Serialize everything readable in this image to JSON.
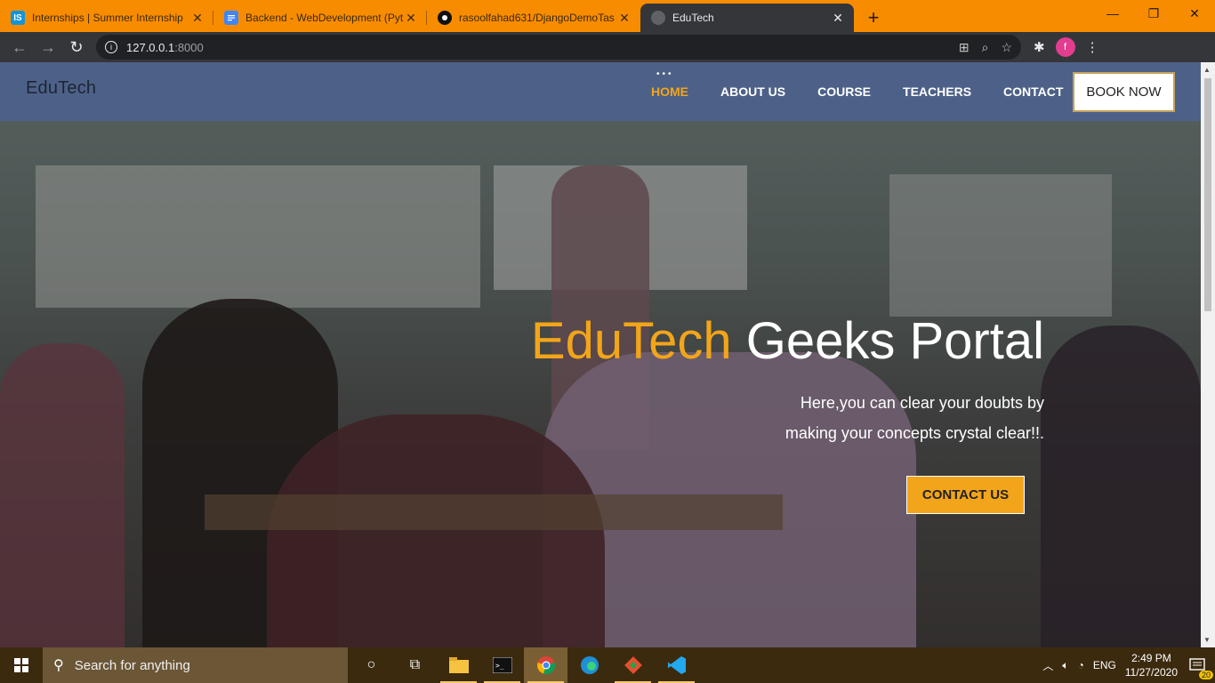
{
  "browser": {
    "tabs": [
      {
        "title": "Internships | Summer Internship",
        "favicon": "internshala-icon",
        "favicon_text": "IS",
        "active": false
      },
      {
        "title": "Backend - WebDevelopment (Pyt",
        "favicon": "google-docs-icon",
        "active": false
      },
      {
        "title": "rasoolfahad631/DjangoDemoTas",
        "favicon": "github-icon",
        "active": false
      },
      {
        "title": "EduTech",
        "favicon": "globe-icon",
        "active": true
      }
    ],
    "url_host": "127.0.0.1",
    "url_port": ":8000",
    "profile_initial": "f",
    "accent_color": "#f88c00"
  },
  "site": {
    "brand": "EduTech",
    "nav": [
      {
        "label": "HOME",
        "active": true
      },
      {
        "label": "ABOUT US",
        "active": false
      },
      {
        "label": "COURSE",
        "active": false
      },
      {
        "label": "TEACHERS",
        "active": false
      },
      {
        "label": "CONTACT",
        "active": false
      }
    ],
    "book_now": "BOOK NOW",
    "hero": {
      "title_highlight": "EduTech",
      "title_rest": " Geeks Portal",
      "subtitle_line1": "Here,you can clear your doubts by",
      "subtitle_line2": "making your concepts crystal clear!!.",
      "cta": "CONTACT US"
    },
    "colors": {
      "nav_bg": "#4d6188",
      "highlight": "#f2a51a"
    }
  },
  "taskbar": {
    "search_placeholder": "Search for anything",
    "time": "2:49 PM",
    "date": "11/27/2020",
    "language": "ENG",
    "notifications": "20"
  }
}
